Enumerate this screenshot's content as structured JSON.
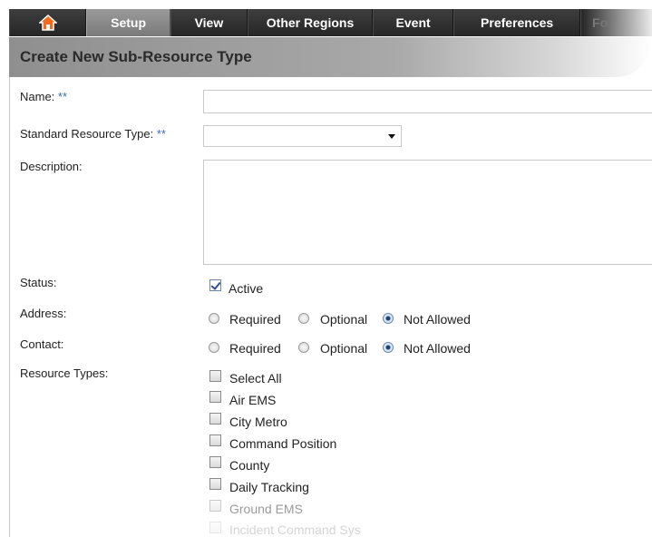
{
  "nav": {
    "home_icon": "home-icon",
    "items": [
      "Setup",
      "View",
      "Other Regions",
      "Event",
      "Preferences",
      "Fo"
    ],
    "accent_color": "#f26b1d"
  },
  "page": {
    "title": "Create New Sub-Resource Type"
  },
  "form": {
    "name_label": "Name:",
    "std_type_label": "Standard Resource Type:",
    "required_marker": "**",
    "description_label": "Description:",
    "status_label": "Status:",
    "status_active": "Active",
    "address_label": "Address:",
    "contact_label": "Contact:",
    "options": [
      "Required",
      "Optional",
      "Not Allowed"
    ],
    "address_selected": "Not Allowed",
    "contact_selected": "Not Allowed",
    "resource_types_label": "Resource Types:",
    "resource_types": [
      "Select All",
      "Air EMS",
      "City Metro",
      "Command Position",
      "County",
      "Daily Tracking",
      "Ground EMS",
      "Incident Command Sys"
    ]
  }
}
